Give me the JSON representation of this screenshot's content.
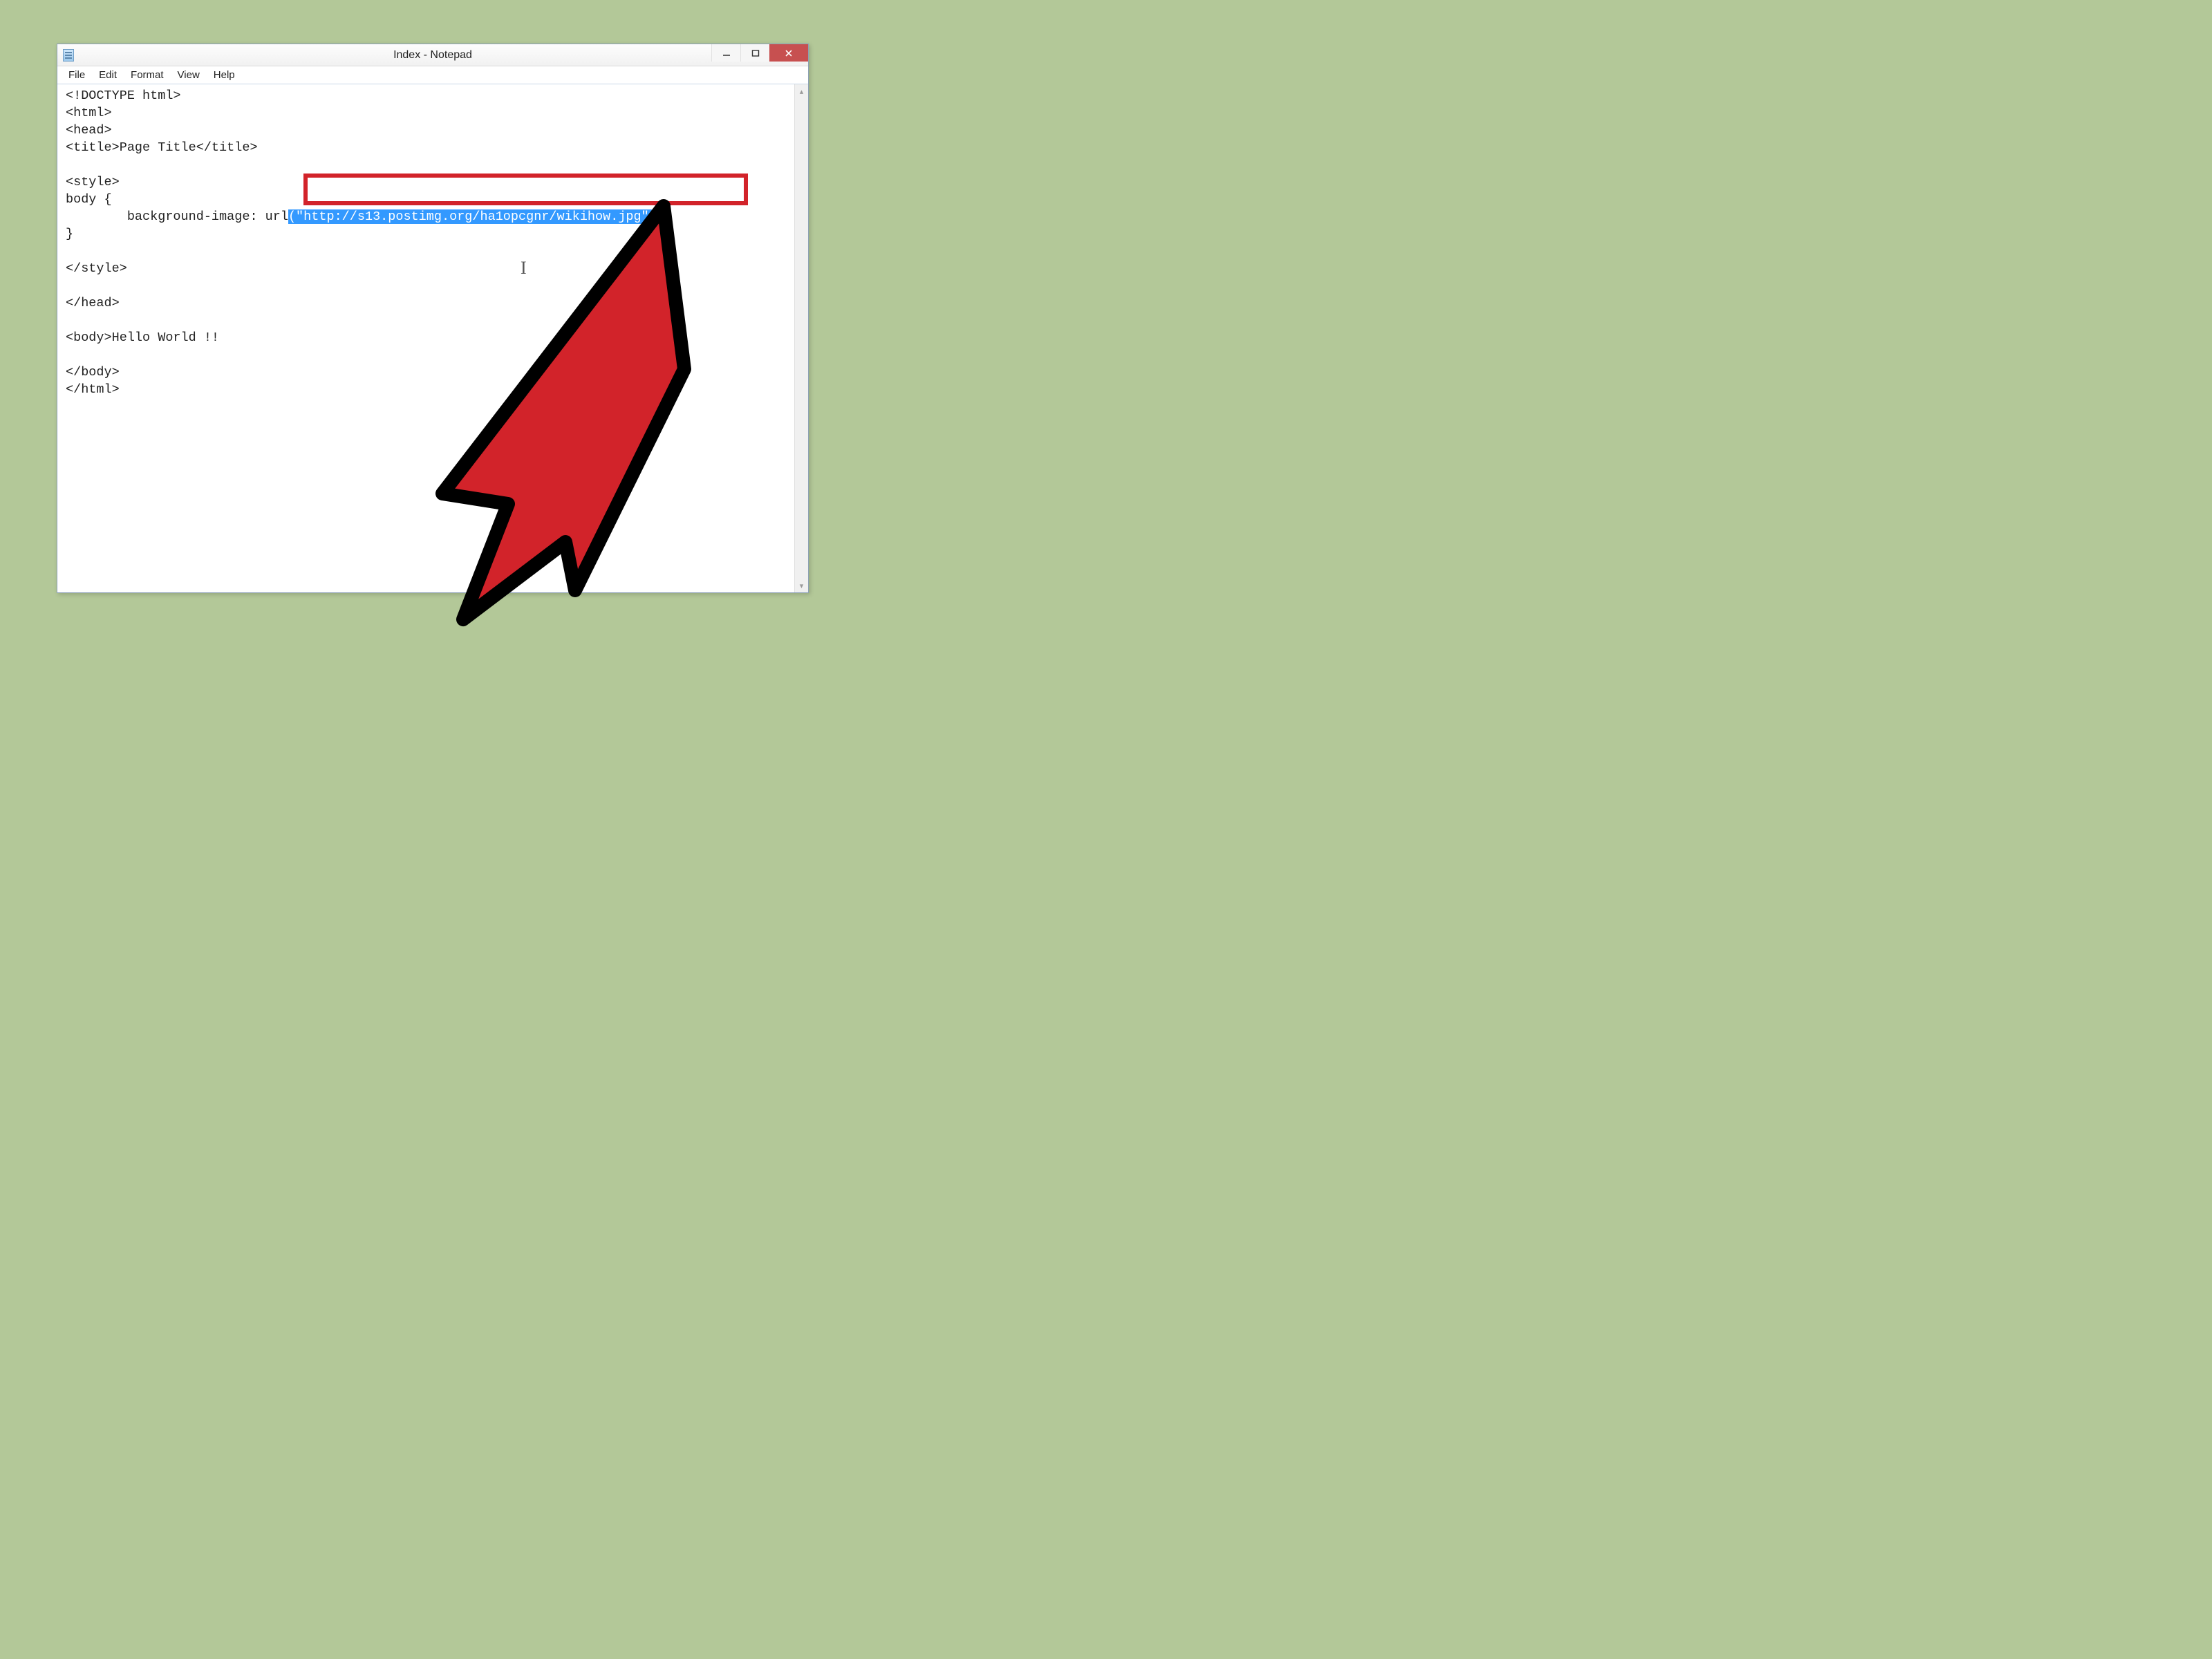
{
  "window": {
    "title": "Index - Notepad"
  },
  "menu": {
    "file": "File",
    "edit": "Edit",
    "format": "Format",
    "view": "View",
    "help": "Help"
  },
  "editor": {
    "line1": "<!DOCTYPE html>",
    "line2": "<html>",
    "line3": "<head>",
    "line4": "<title>Page Title</title>",
    "line5": "",
    "line6": "<style>",
    "line7": "body {",
    "line8a": "        background-image: url",
    "line8b_selected": "(\"http://s13.postimg.org/ha1opcgnr/wikihow.jpg\");",
    "line9": "}",
    "line10": "",
    "line11": "</style>",
    "line12": "",
    "line13": "</head>",
    "line14": "",
    "line15": "<body>Hello World !!",
    "line16": "",
    "line17": "</body>",
    "line18": "</html>"
  },
  "annotation": {
    "highlight_color": "#d2232a",
    "arrow_fill": "#d2232a",
    "arrow_stroke": "#000000"
  }
}
